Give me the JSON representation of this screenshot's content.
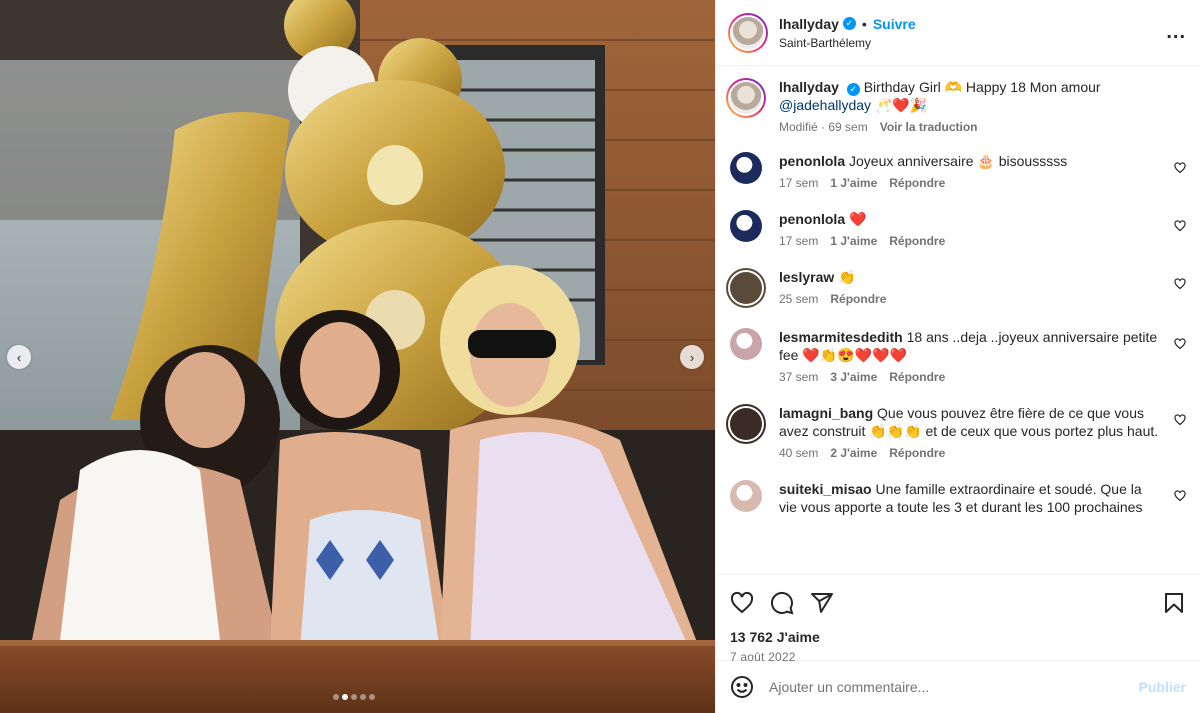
{
  "media": {
    "carousel_total": 5,
    "carousel_active_index": 2,
    "prev_icon": "chevron-left-icon",
    "next_icon": "chevron-right-icon"
  },
  "header": {
    "username": "lhallyday",
    "verified_glyph": "✓",
    "separator": "•",
    "follow_label": "Suivre",
    "location": "Saint-Barthélemy",
    "more_label": "..."
  },
  "caption": {
    "username": "lhallyday",
    "text": "Birthday Girl 🫶 Happy 18 Mon amour",
    "mention": "@jadehallyday",
    "emojis": " 🥂❤️🎉",
    "edited": "Modifié · 69 sem",
    "translate": "Voir la traduction"
  },
  "comments": [
    {
      "username": "penonlola",
      "text": "Joyeux anniversaire 🎂 bisousssss",
      "time": "17 sem",
      "likes": "1 J'aime",
      "reply": "Répondre",
      "avatar_color": "#1c2a5e"
    },
    {
      "username": "penonlola",
      "text": "❤️",
      "time": "17 sem",
      "likes": "1 J'aime",
      "reply": "Répondre",
      "avatar_color": "#1c2a5e"
    },
    {
      "username": "leslyraw",
      "text": "👏",
      "time": "25 sem",
      "likes": "",
      "reply": "Répondre",
      "avatar_color": "#5a4a3a"
    },
    {
      "username": "lesmarmitesdedith",
      "text": "18 ans ..deja ..joyeux anniversaire petite fee ❤️👏😍❤️❤️❤️",
      "time": "37 sem",
      "likes": "3 J'aime",
      "reply": "Répondre",
      "avatar_color": "#c9a4a8"
    },
    {
      "username": "lamagni_bang",
      "text": "Que vous pouvez être fière de ce que vous avez construit 👏👏👏 et de ceux que vous portez plus haut.",
      "time": "40 sem",
      "likes": "2 J'aime",
      "reply": "Répondre",
      "avatar_color": "#3b2b25"
    },
    {
      "username": "suiteki_misao",
      "text": "Une famille extraordinaire et soudé. Que la vie vous apporte a toute les 3 et durant les 100 prochaines",
      "time": "",
      "likes": "",
      "reply": "",
      "avatar_color": "#d8b9b0"
    }
  ],
  "actions": {
    "like_icon": "heart-icon",
    "comment_icon": "comment-icon",
    "share_icon": "share-icon",
    "save_icon": "bookmark-icon",
    "likes_count": "13 762 J'aime",
    "date": "7 août 2022"
  },
  "add_comment": {
    "emoji_icon": "emoji-icon",
    "placeholder": "Ajouter un commentaire...",
    "publish_label": "Publier"
  },
  "colors": {
    "accent": "#0095f6",
    "text": "#262626",
    "muted": "#737373",
    "publish_disabled": "#c0dffd"
  }
}
